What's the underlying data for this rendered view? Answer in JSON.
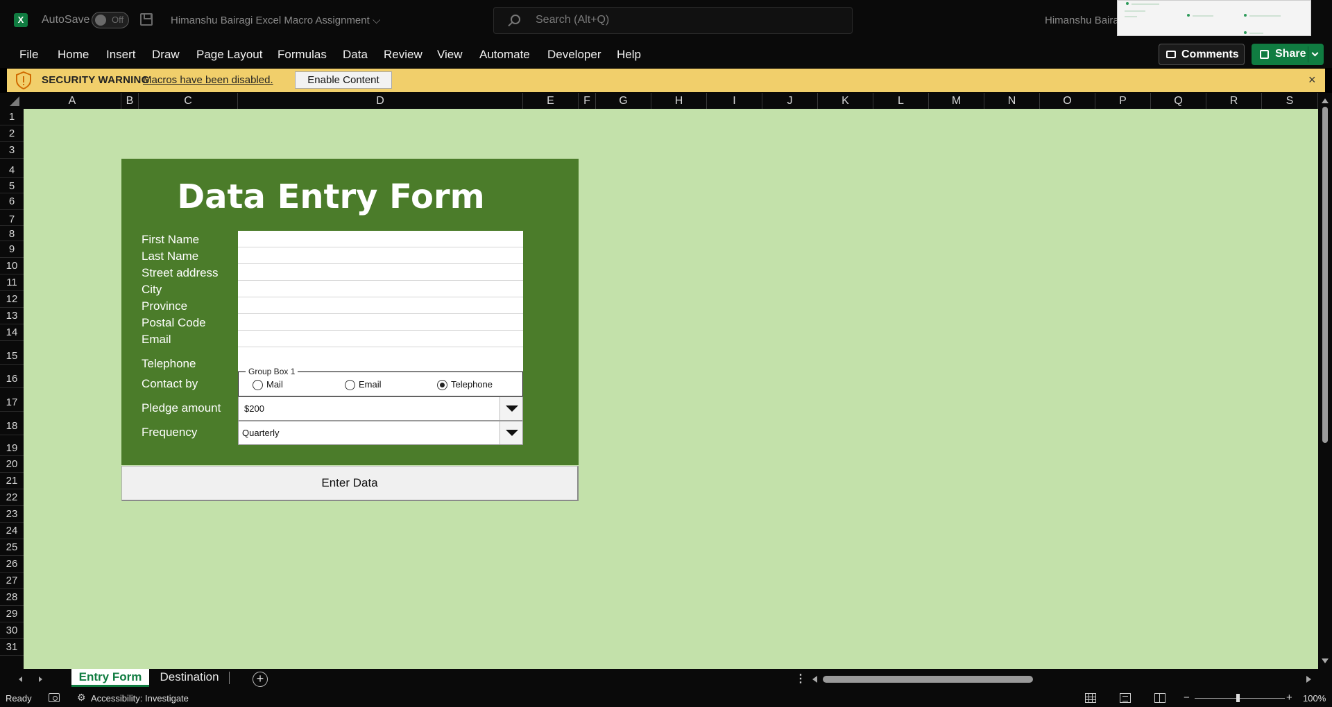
{
  "app": {
    "logo": "X",
    "autosave_label": "AutoSave",
    "autosave_state": "Off",
    "document_title": "Himanshu Bairagi Excel Macro Assignment",
    "search_placeholder": "Search (Alt+Q)",
    "user_name": "Himanshu Baira"
  },
  "ribbon": {
    "tabs": [
      "File",
      "Home",
      "Insert",
      "Draw",
      "Page Layout",
      "Formulas",
      "Data",
      "Review",
      "View",
      "Automate",
      "Developer",
      "Help"
    ],
    "comments_label": "Comments",
    "share_label": "Share"
  },
  "security_bar": {
    "title": "SECURITY WARNING",
    "message": "Macros have been disabled.",
    "button_label": "Enable Content",
    "close_glyph": "×"
  },
  "grid": {
    "columns": [
      "A",
      "B",
      "C",
      "D",
      "E",
      "F",
      "G",
      "H",
      "I",
      "J",
      "K",
      "L",
      "M",
      "N",
      "O",
      "P",
      "Q",
      "R",
      "S"
    ],
    "rows": [
      "1",
      "2",
      "3",
      "4",
      "5",
      "6",
      "7",
      "8",
      "9",
      "10",
      "11",
      "12",
      "13",
      "14",
      "15",
      "16",
      "17",
      "18",
      "19",
      "20",
      "21",
      "22",
      "23",
      "24",
      "25",
      "26",
      "27",
      "28",
      "29",
      "30",
      "31"
    ]
  },
  "form": {
    "title": "Data Entry Form",
    "labels": {
      "first_name": "First Name",
      "last_name": "Last Name",
      "street_address": "Street address",
      "city": "City",
      "province": "Province",
      "postal_code": "Postal Code",
      "email": "Email",
      "telephone": "Telephone",
      "contact_by": "Contact by",
      "pledge_amount": "Pledge amount",
      "frequency": "Frequency"
    },
    "group_box_title": "Group Box 1",
    "contact_options": [
      {
        "label": "Mail",
        "selected": false
      },
      {
        "label": "Email",
        "selected": false
      },
      {
        "label": "Telephone",
        "selected": true
      }
    ],
    "pledge_amount_value": "$200",
    "frequency_value": "Quarterly",
    "submit_label": "Enter Data"
  },
  "sheet_tabs": {
    "active": "Entry Form",
    "inactive": "Destination",
    "add_glyph": "+"
  },
  "status": {
    "ready": "Ready",
    "accessibility": "Accessibility: Investigate",
    "zoom": "100%"
  },
  "colors": {
    "form_green": "#4b7c2a",
    "sheet_green": "#c3e1aa",
    "excel_green": "#107c41",
    "warning_yellow": "#f1cf6b"
  }
}
